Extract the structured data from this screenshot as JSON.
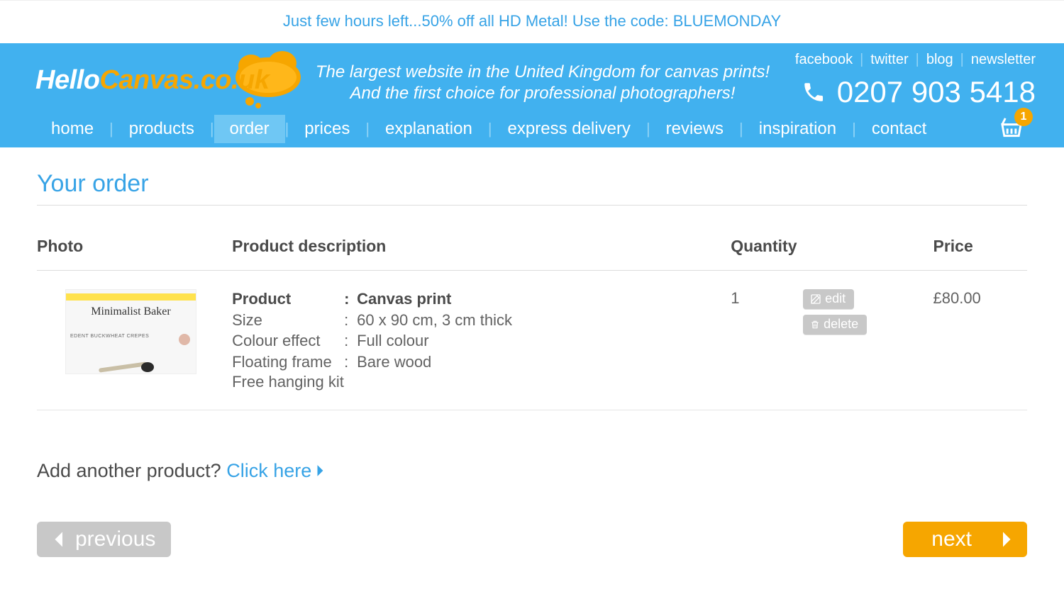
{
  "promo": "Just few hours left...50% off all HD Metal! Use the code: BLUEMONDAY",
  "logo": {
    "hello": "Hello",
    "canvas": "Canvas.co.uk"
  },
  "tagline_line1": "The largest website in the United Kingdom for canvas prints!",
  "tagline_line2": "And the first choice for professional photographers!",
  "top_links": {
    "facebook": "facebook",
    "twitter": "twitter",
    "blog": "blog",
    "newsletter": "newsletter"
  },
  "phone": "0207 903 5418",
  "nav": {
    "items": [
      "home",
      "products",
      "order",
      "prices",
      "explanation",
      "express delivery",
      "reviews",
      "inspiration",
      "contact"
    ],
    "active_index": 2
  },
  "cart_count": "1",
  "page_title": "Your order",
  "table": {
    "headers": {
      "photo": "Photo",
      "desc": "Product description",
      "qty": "Quantity",
      "price": "Price"
    },
    "row": {
      "labels": {
        "product": "Product",
        "size": "Size",
        "colour": "Colour effect",
        "frame": "Floating frame",
        "free": "Free hanging kit"
      },
      "values": {
        "product": "Canvas print",
        "size": "60 x 90 cm, 3 cm thick",
        "colour": "Full colour",
        "frame": "Bare wood"
      },
      "qty": "1",
      "price": "£80.00",
      "actions": {
        "edit": "edit",
        "delete": "delete"
      }
    }
  },
  "add_another": {
    "prefix": "Add another product? ",
    "link": "Click here"
  },
  "buttons": {
    "previous": "previous",
    "next": "next"
  },
  "thumb": {
    "script_text": "Minimalist Baker",
    "sub_text": "EDENT BUCKWHEAT CREPES"
  }
}
